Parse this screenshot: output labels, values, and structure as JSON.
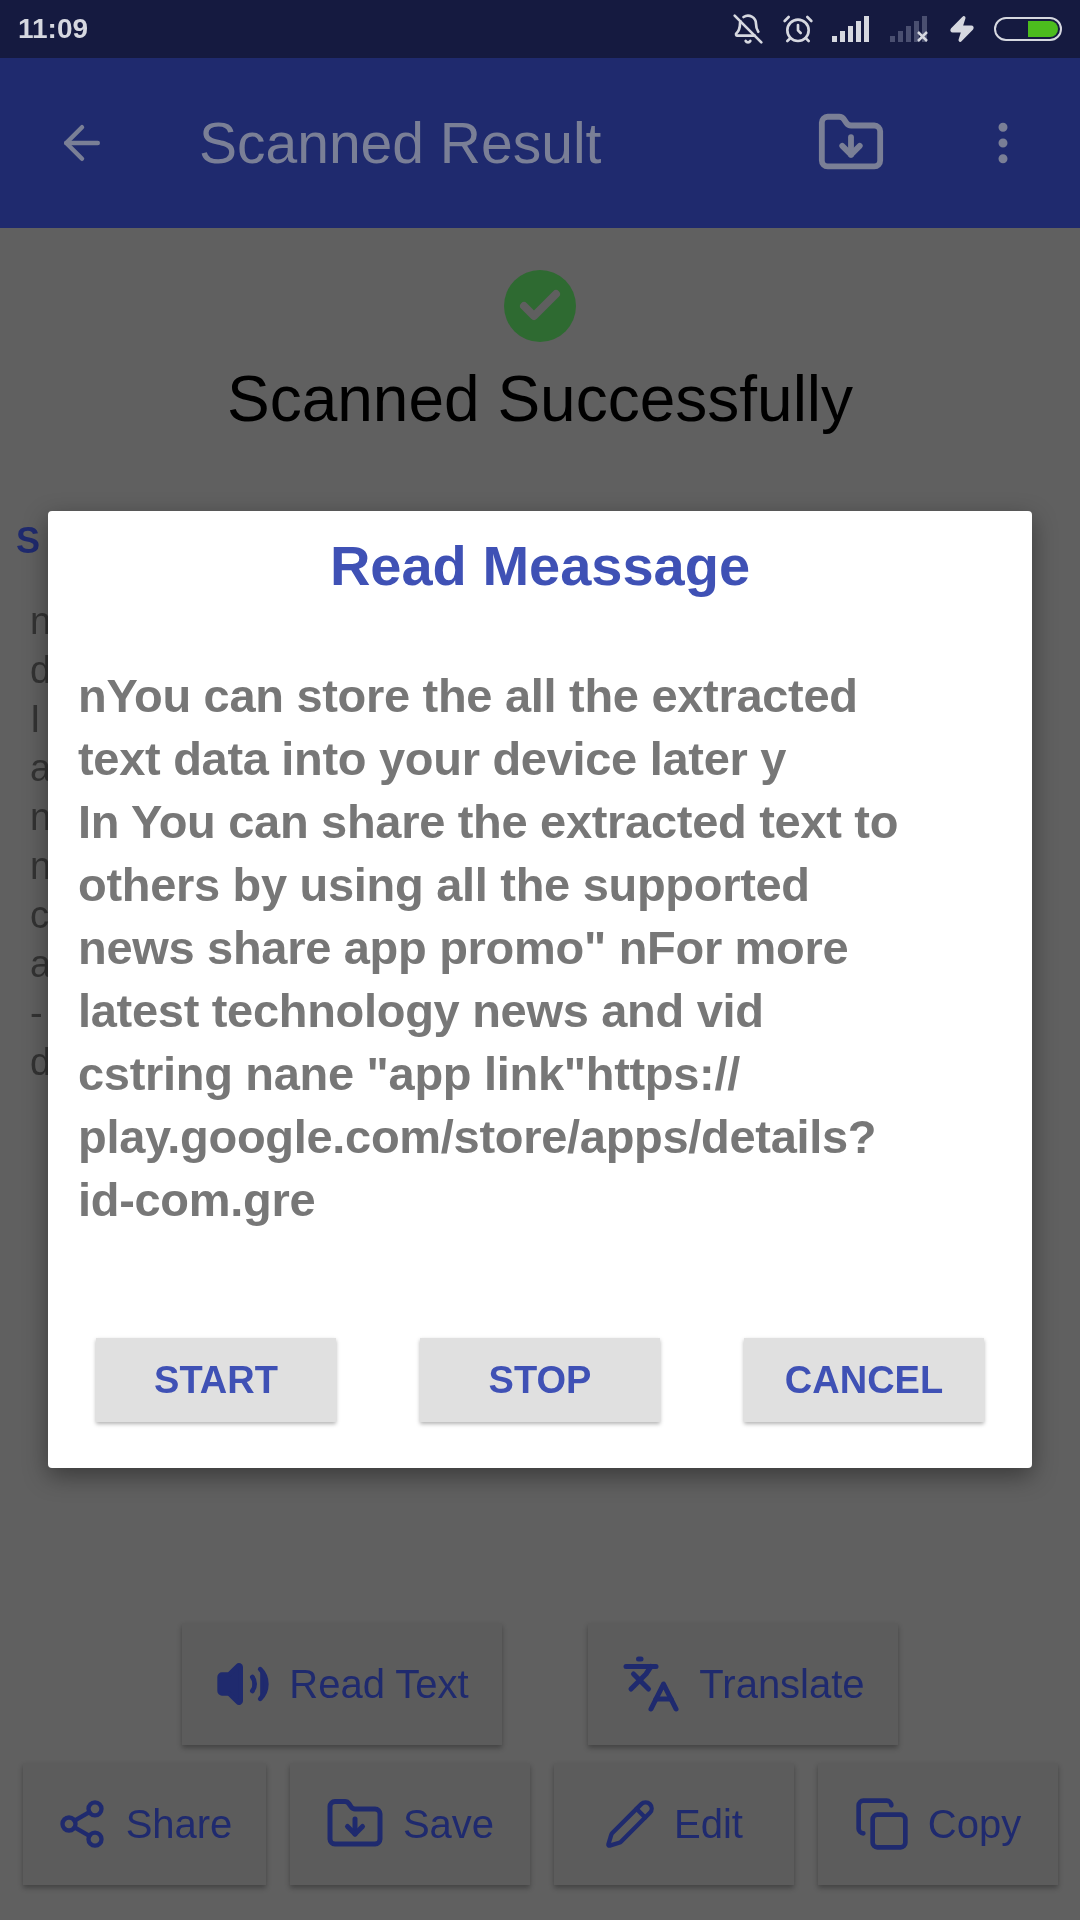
{
  "status_bar": {
    "time": "11:09"
  },
  "app_bar": {
    "title": "Scanned Result"
  },
  "result": {
    "heading": "Scanned Successfully",
    "section_title": "S",
    "text_fragments": [
      "n",
      "d",
      "I",
      "a",
      "n",
      "n",
      "c",
      "a",
      "-",
      "d"
    ]
  },
  "dialog": {
    "title": "Read Meassage",
    "lines": [
      "nYou can store the all the extracted",
      "text data into your device later y",
      "In You can share the extracted text to",
      "others by using all the supported",
      "news share app promo\" nFor more",
      "latest technology news and vid",
      "cstring nane \"app link\"https://",
      "play.google.com/store/apps/details?",
      "id-com.gre"
    ],
    "buttons": [
      "START",
      "STOP",
      "CANCEL"
    ]
  },
  "actions": [
    [
      {
        "kind": "speaker",
        "label": "Read Text"
      },
      {
        "kind": "translate",
        "label": "Translate"
      }
    ],
    [
      {
        "kind": "share",
        "label": "Share"
      },
      {
        "kind": "save",
        "label": "Save"
      },
      {
        "kind": "edit",
        "label": "Edit"
      },
      {
        "kind": "copy",
        "label": "Copy"
      }
    ]
  ]
}
